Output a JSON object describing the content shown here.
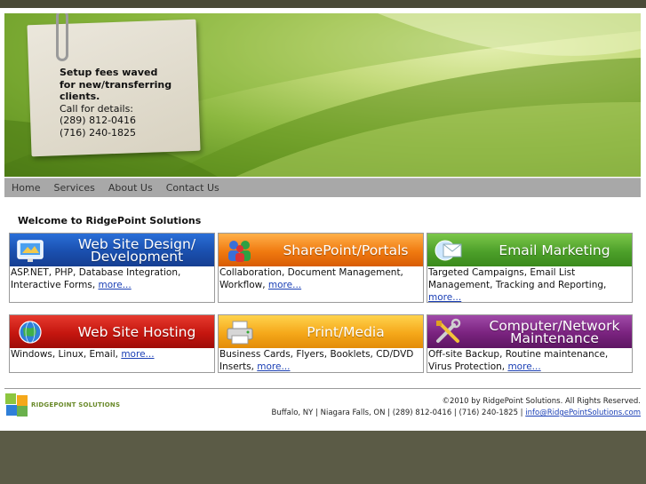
{
  "note": {
    "bold_lines": [
      "Setup fees waved",
      "for new/transferring",
      "clients."
    ],
    "lines": [
      "Call for details:",
      "(289) 812-0416",
      "(716) 240-1825"
    ]
  },
  "nav": [
    "Home",
    "Services",
    "About Us",
    "Contact Us"
  ],
  "welcome": "Welcome to RidgePoint Solutions",
  "services": [
    {
      "title": "Web Site Design/\nDevelopment",
      "text": "ASP.NET, PHP, Database Integration, Interactive Forms,",
      "more": "more...",
      "icon": "web-design-icon",
      "color": "#1a4fae"
    },
    {
      "title": "SharePoint/Portals",
      "text": "Collaboration, Document Management, Workflow,",
      "more": "more...",
      "icon": "users-icon",
      "color": "#f07a10"
    },
    {
      "title": "Email Marketing",
      "text": "Targeted Campaigns, Email List Management, Tracking and Reporting,",
      "more": "more...",
      "icon": "envelope-icon",
      "color": "#4da02a"
    },
    {
      "title": "Web Site Hosting",
      "text": "Windows, Linux, Email,",
      "more": "more...",
      "icon": "globe-icon",
      "color": "#c5160f"
    },
    {
      "title": "Print/Media",
      "text": "Business Cards, Flyers, Booklets, CD/DVD Inserts,",
      "more": "more...",
      "icon": "printer-icon",
      "color": "#f5a81a"
    },
    {
      "title": "Computer/Network\nMaintenance",
      "text": "Off-site Backup, Routine maintenance, Virus Protection,",
      "more": "more...",
      "icon": "tools-icon",
      "color": "#7a237f"
    }
  ],
  "footer": {
    "logo_text": "RIDGEPOINT SOLUTIONS",
    "copyright": "©2010 by RidgePoint Solutions. All Rights Reserved.",
    "contact": "Buffalo, NY | Niagara Falls, ON | (289) 812-0416 | (716) 240-1825 |",
    "email": "info@RidgePointSolutions.com"
  }
}
